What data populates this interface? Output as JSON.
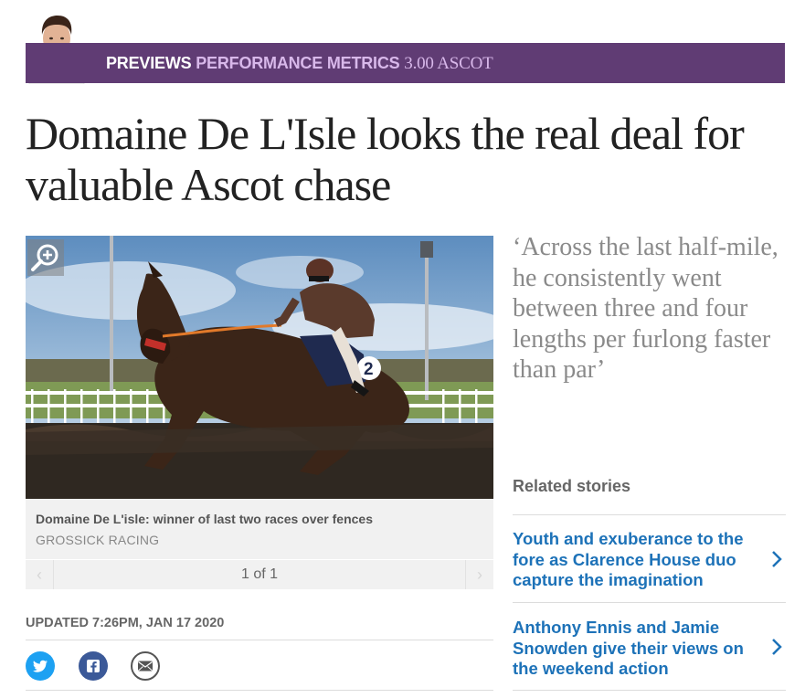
{
  "banner": {
    "section": "PREVIEWS",
    "category": "PERFORMANCE METRICS",
    "race": "3.00 ASCOT"
  },
  "headline": "Domaine De L'Isle looks the real deal for valuable Ascot chase",
  "photo": {
    "saddle_number": "2",
    "caption": "Domaine De L'isle: winner of last two races over fences",
    "credit": "GROSSICK RACING"
  },
  "gallery": {
    "count": "1 of 1"
  },
  "pullquote": "‘Across the last half-mile, he consistently went between three and four lengths per furlong faster than par’",
  "related": {
    "title": "Related stories",
    "items": [
      {
        "label": "Youth and exuberance to the fore as Clarence House duo capture the imagination"
      },
      {
        "label": "Anthony Ennis and Jamie Snowden give their views on the weekend action"
      }
    ]
  },
  "meta": {
    "updated": "UPDATED 7:26PM, JAN 17 2020"
  },
  "colors": {
    "banner": "#603c74",
    "twitter": "#1da1f2",
    "facebook": "#3b5998",
    "email": "#555555",
    "link": "#1d72b8"
  },
  "icons": [
    "author-avatar",
    "zoom-icon",
    "chevron-right-icon",
    "twitter-icon",
    "facebook-icon",
    "email-icon"
  ]
}
